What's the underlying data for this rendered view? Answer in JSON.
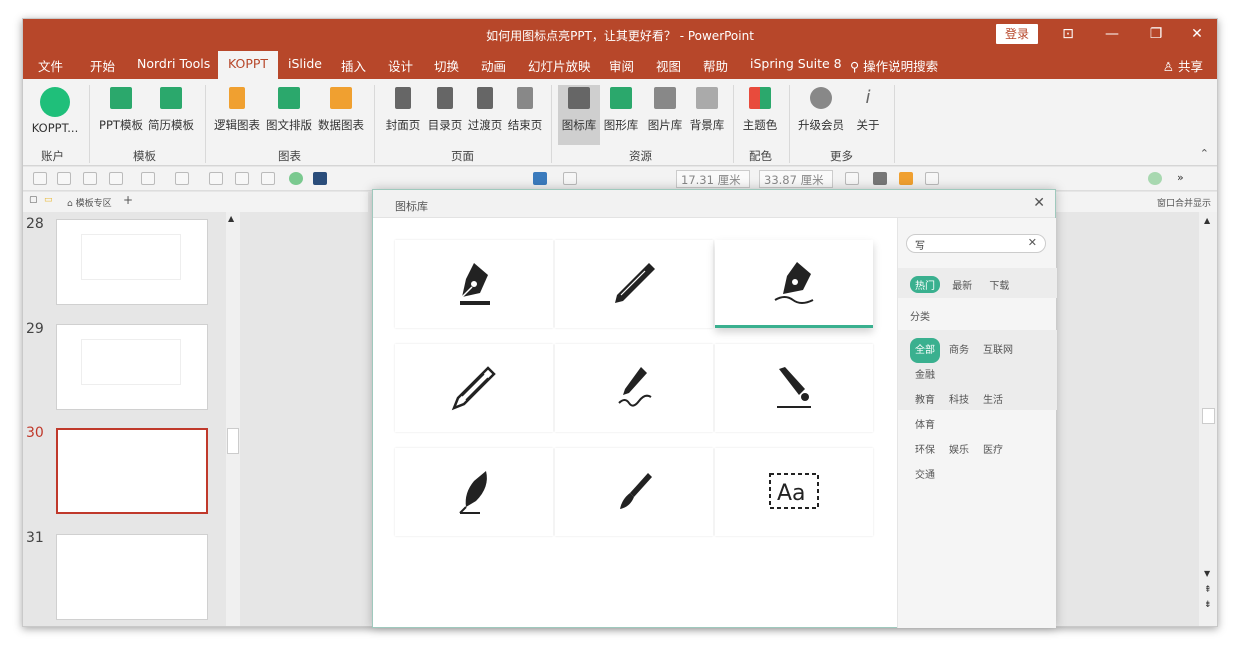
{
  "window": {
    "title": "如何用图标点亮PPT，让其更好看？ - PowerPoint",
    "login": "登录",
    "share": "共享"
  },
  "tabs": [
    "文件",
    "开始",
    "Nordri Tools",
    "KOPPT",
    "iSlide",
    "插入",
    "设计",
    "切换",
    "动画",
    "幻灯片放映",
    "审阅",
    "视图",
    "帮助",
    "iSpring Suite 8",
    "操作说明搜索"
  ],
  "ribbon": {
    "buttons": {
      "koppt": "KOPPT...",
      "ppt_template": "PPT模板",
      "resume_template": "简历模板",
      "logic_chart": "逻辑图表",
      "text_layout": "图文排版",
      "data_chart": "数据图表",
      "cover": "封面页",
      "toc": "目录页",
      "transition": "过渡页",
      "end": "结束页",
      "icon_lib": "图标库",
      "shape_lib": "图形库",
      "image_lib": "图片库",
      "bg_lib": "背景库",
      "theme_color": "主题色",
      "upgrade": "升级会员",
      "about": "关于"
    },
    "groups": {
      "account": "账户",
      "template": "模板",
      "chart": "图表",
      "page": "页面",
      "resource": "资源",
      "color": "配色",
      "more": "更多"
    }
  },
  "toolbar": {
    "width": "17.31 厘米",
    "height": "33.87 厘米"
  },
  "panel": {
    "template_zone": "模板专区",
    "merge_window": "窗口合并显示"
  },
  "slides": [
    "28",
    "29",
    "30",
    "31"
  ],
  "dialog": {
    "title": "图标库",
    "search_value": "写",
    "tabs": [
      "热门",
      "最新",
      "下载"
    ],
    "category_label": "分类",
    "categories": [
      "全部",
      "商务",
      "互联网",
      "金融",
      "教育",
      "科技",
      "生活",
      "体育",
      "环保",
      "娱乐",
      "医疗",
      "交通"
    ]
  },
  "colors": {
    "brand": "#b7472a",
    "accent": "#3ab08f"
  }
}
